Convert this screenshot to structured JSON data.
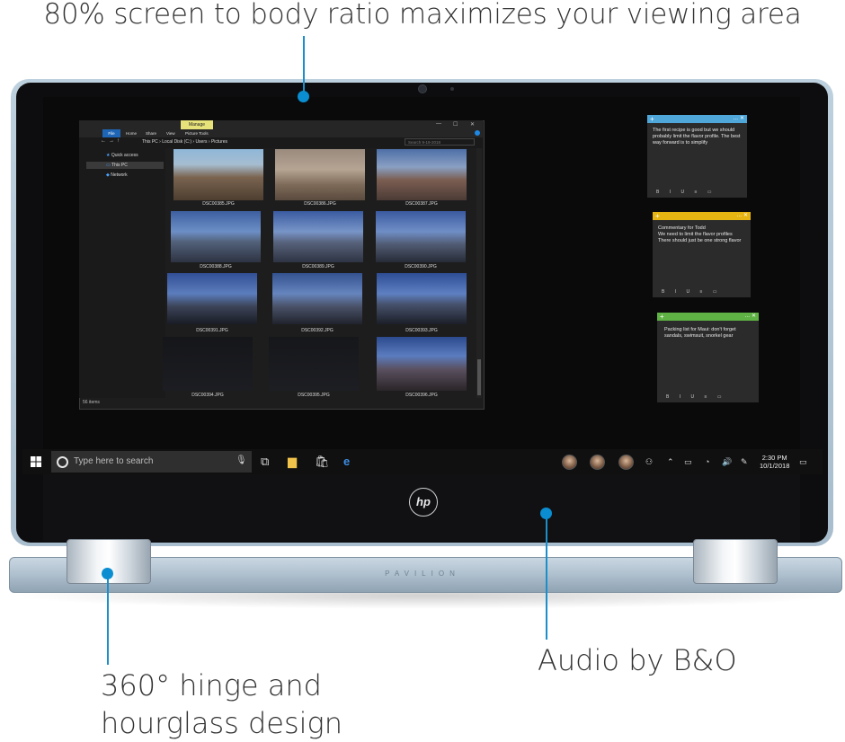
{
  "callouts": {
    "top": "80% screen to body ratio maximizes your viewing area",
    "hinge_line1": "360° hinge and",
    "hinge_line2": "hourglass design",
    "audio": "Audio by B&O"
  },
  "colors": {
    "accent": "#0a8ed1",
    "note_blue": "#4fa7d9",
    "note_yellow": "#e7b512",
    "note_green": "#5fb344"
  },
  "laptop": {
    "brand": "hp",
    "model": "PAVILION"
  },
  "explorer": {
    "manage_tab": "Manage",
    "tabs": [
      "File",
      "Home",
      "Share",
      "View",
      "Picture Tools"
    ],
    "breadcrumb": "This PC  ›  Local Disk (C:)  ›  Users  ›  Pictures",
    "search_placeholder": "Search 9-19-2018",
    "nav": [
      "Quick access",
      "This PC",
      "Network"
    ],
    "status": "56 items",
    "files": [
      "DSC00385.JPG",
      "DSC00386.JPG",
      "DSC00387.JPG",
      "DSC00388.JPG",
      "DSC00389.JPG",
      "DSC00390.JPG",
      "DSC00391.JPG",
      "DSC00392.JPG",
      "DSC00393.JPG",
      "DSC00394.JPG",
      "DSC00395.JPG",
      "DSC00396.JPG"
    ]
  },
  "notes": [
    {
      "text": "The first recipe is good but we should probably limit the flavor profile. The best way forward is to simplify"
    },
    {
      "text": "Commentary for Todd\nWe need to limit the flavor profiles\nThere should just be one strong flavor"
    },
    {
      "text": "Packing list for Maui: don't forget sandals, swimsuit, snorkel gear"
    }
  ],
  "note_tools": "B I U ≡ ▭",
  "taskbar": {
    "search_placeholder": "Type here to search",
    "time": "2:30 PM",
    "date": "10/1/2018"
  }
}
